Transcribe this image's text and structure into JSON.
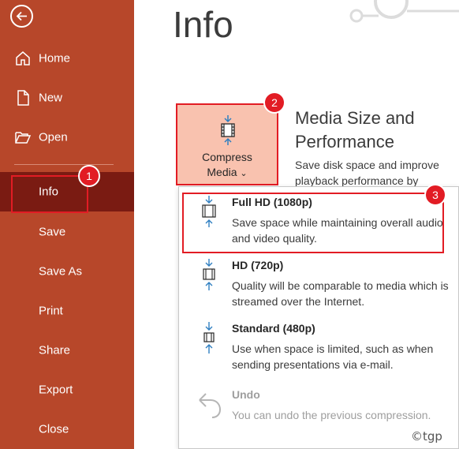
{
  "sidebar": {
    "items": [
      {
        "label": "Home",
        "icon": "home-icon"
      },
      {
        "label": "New",
        "icon": "new-document-icon"
      },
      {
        "label": "Open",
        "icon": "folder-open-icon"
      },
      {
        "label": "Info"
      },
      {
        "label": "Save"
      },
      {
        "label": "Save As"
      },
      {
        "label": "Print"
      },
      {
        "label": "Share"
      },
      {
        "label": "Export"
      },
      {
        "label": "Close"
      }
    ],
    "active": "Info"
  },
  "main": {
    "title": "Info",
    "compress_button": {
      "line1": "Compress",
      "line2": "Media",
      "chevron": "⌄"
    },
    "section_title": "Media Size and Performance",
    "section_desc": "Save disk space and improve playback performance by"
  },
  "dropdown": {
    "options": [
      {
        "title": "Full HD (1080p)",
        "desc": "Save space while maintaining overall audio and video quality."
      },
      {
        "title": "HD (720p)",
        "desc": "Quality will be comparable to media which is streamed over the Internet."
      },
      {
        "title": "Standard (480p)",
        "desc": "Use when space is limited, such as when sending presentations via e-mail."
      },
      {
        "title": "Undo",
        "desc": "You can undo the previous compression.",
        "disabled": true
      }
    ]
  },
  "annotations": {
    "step1": "1",
    "step2": "2",
    "step3": "3"
  },
  "watermark": "©tgp",
  "colors": {
    "sidebar": "#b7472a",
    "active_item": "#7a1b12",
    "accent_red": "#e21c24",
    "compress_bg": "#f9c2af"
  }
}
